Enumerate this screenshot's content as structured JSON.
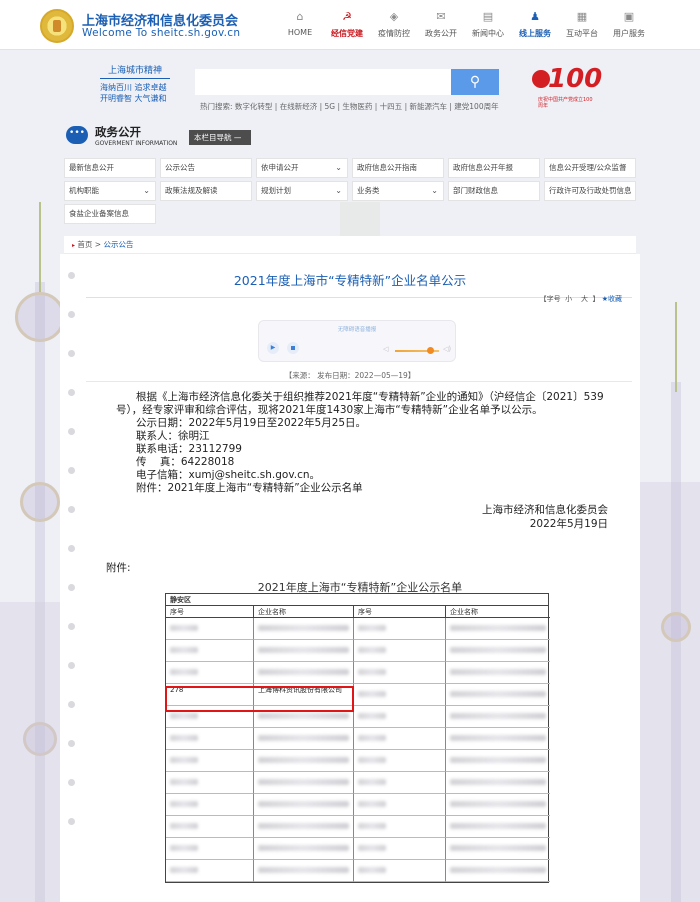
{
  "header": {
    "site_title": "上海市经济和信息化委员会",
    "site_sub": "Welcome To sheitc.sh.gov.cn",
    "nav": [
      {
        "icon": "home-icon",
        "glyph": "⌂",
        "label": "HOME",
        "style": "normal"
      },
      {
        "icon": "party-emblem-icon",
        "glyph": "☭",
        "label": "经信党建",
        "style": "red"
      },
      {
        "icon": "shield-icon",
        "glyph": "◈",
        "label": "疫情防控",
        "style": "normal"
      },
      {
        "icon": "chat-icon",
        "glyph": "✉",
        "label": "政务公开",
        "style": "normal"
      },
      {
        "icon": "book-icon",
        "glyph": "▤",
        "label": "新闻中心",
        "style": "normal"
      },
      {
        "icon": "users-icon",
        "glyph": "♟",
        "label": "线上服务",
        "style": "blue"
      },
      {
        "icon": "grid-icon",
        "glyph": "▦",
        "label": "互动平台",
        "style": "normal"
      },
      {
        "icon": "user-service-icon",
        "glyph": "▣",
        "label": "用户服务",
        "style": "normal"
      }
    ]
  },
  "spirit": {
    "title": "上海城市精神",
    "line1": "海纳百川  追求卓越",
    "line2": "开明睿智  大气谦和"
  },
  "search": {
    "placeholder": "",
    "button_glyph": "⚲",
    "hot_label": "热门搜索:",
    "hot_terms": "数字化转型 | 在线新经济 | 5G | 生物医药 | 十四五 | 新能源汽车 | 建党100周年"
  },
  "badge": {
    "number": "100",
    "caption": "庆祝中国共产党成立100周年"
  },
  "gov": {
    "icon_glyph": "•••",
    "title": "政务公开",
    "sub": "GOVERMENT INFORMATION",
    "section_nav": "本栏目导航  —"
  },
  "categories": [
    {
      "label": "最新信息公开",
      "dropdown": ""
    },
    {
      "label": "公示公告",
      "dropdown": ""
    },
    {
      "label": "依申请公开",
      "dropdown": "⌄"
    },
    {
      "label": "政府信息公开指南",
      "dropdown": ""
    },
    {
      "label": "政府信息公开年报",
      "dropdown": ""
    },
    {
      "label": "信息公开受理/公众监督",
      "dropdown": ""
    },
    {
      "label": "机构职能",
      "dropdown": "⌄"
    },
    {
      "label": "政策法规及解读",
      "dropdown": ""
    },
    {
      "label": "规划计划",
      "dropdown": "⌄"
    },
    {
      "label": "业务类",
      "dropdown": "⌄"
    },
    {
      "label": "部门财政信息",
      "dropdown": ""
    },
    {
      "label": "行政许可及行政处罚信息",
      "dropdown": ""
    },
    {
      "label": "食盐企业备案信息",
      "dropdown": ""
    }
  ],
  "breadcrumb": {
    "arrow": "▸",
    "home": "首页",
    "sep": ">",
    "current": "公示公告"
  },
  "article": {
    "title": "2021年度上海市“专精特新”企业名单公示",
    "font_label": "【字号",
    "font_small": "小",
    "font_large": "大",
    "font_end": "】",
    "favorite": "★收藏",
    "player_title": "无障碍语音播报",
    "player_play": "▶",
    "meta": "【来源：   发布日期：2022—05—19】",
    "paragraphs": [
      "      根据《上海市经济信息化委关于组织推荐2021年度“专精特新”企业的通知》（沪经信企〔2021〕539号），经专家评审和综合评估，现将2021年度1430家上海市“专精特新”企业名单予以公示。",
      "      公示日期：2022年5月19日至2022年5月25日。",
      "      联系人：徐明江",
      "      联系电话：23112799",
      "      传    真：64228018",
      "      电子信箱：xumj@sheitc.sh.gov.cn。",
      "      附件：2021年度上海市“专精特新”企业公示名单"
    ],
    "sign_org": "上海市经济和信息化委员会",
    "sign_date": "2022年5月19日",
    "attach_label": "附件:",
    "list_title": "2021年度上海市“专精特新”企业公示名单"
  },
  "table": {
    "district": "静安区",
    "headers": [
      "序号",
      "企业名称",
      "序号",
      "企业名称"
    ],
    "rows": [
      {
        "seq1": "",
        "name1": "",
        "seq2": "",
        "name2": "",
        "visible": false
      },
      {
        "seq1": "",
        "name1": "",
        "seq2": "",
        "name2": "",
        "visible": false
      },
      {
        "seq1": "",
        "name1": "",
        "seq2": "",
        "name2": "",
        "visible": false
      },
      {
        "seq1": "278",
        "name1": "上海博科资讯股份有限公司",
        "seq2": "",
        "name2": "",
        "visible": true
      },
      {
        "seq1": "",
        "name1": "",
        "seq2": "",
        "name2": "",
        "visible": false
      },
      {
        "seq1": "",
        "name1": "",
        "seq2": "",
        "name2": "",
        "visible": false
      },
      {
        "seq1": "",
        "name1": "",
        "seq2": "",
        "name2": "",
        "visible": false
      },
      {
        "seq1": "",
        "name1": "",
        "seq2": "",
        "name2": "",
        "visible": false
      },
      {
        "seq1": "",
        "name1": "",
        "seq2": "",
        "name2": "",
        "visible": false
      },
      {
        "seq1": "",
        "name1": "",
        "seq2": "",
        "name2": "",
        "visible": false
      },
      {
        "seq1": "",
        "name1": "",
        "seq2": "",
        "name2": "",
        "visible": false
      },
      {
        "seq1": "",
        "name1": "",
        "seq2": "",
        "name2": "",
        "visible": false
      }
    ]
  },
  "colors": {
    "brand_blue": "#1a5fb4",
    "party_red": "#c8161d",
    "highlight_red": "#e01515",
    "search_blue": "#5a9ae8"
  }
}
